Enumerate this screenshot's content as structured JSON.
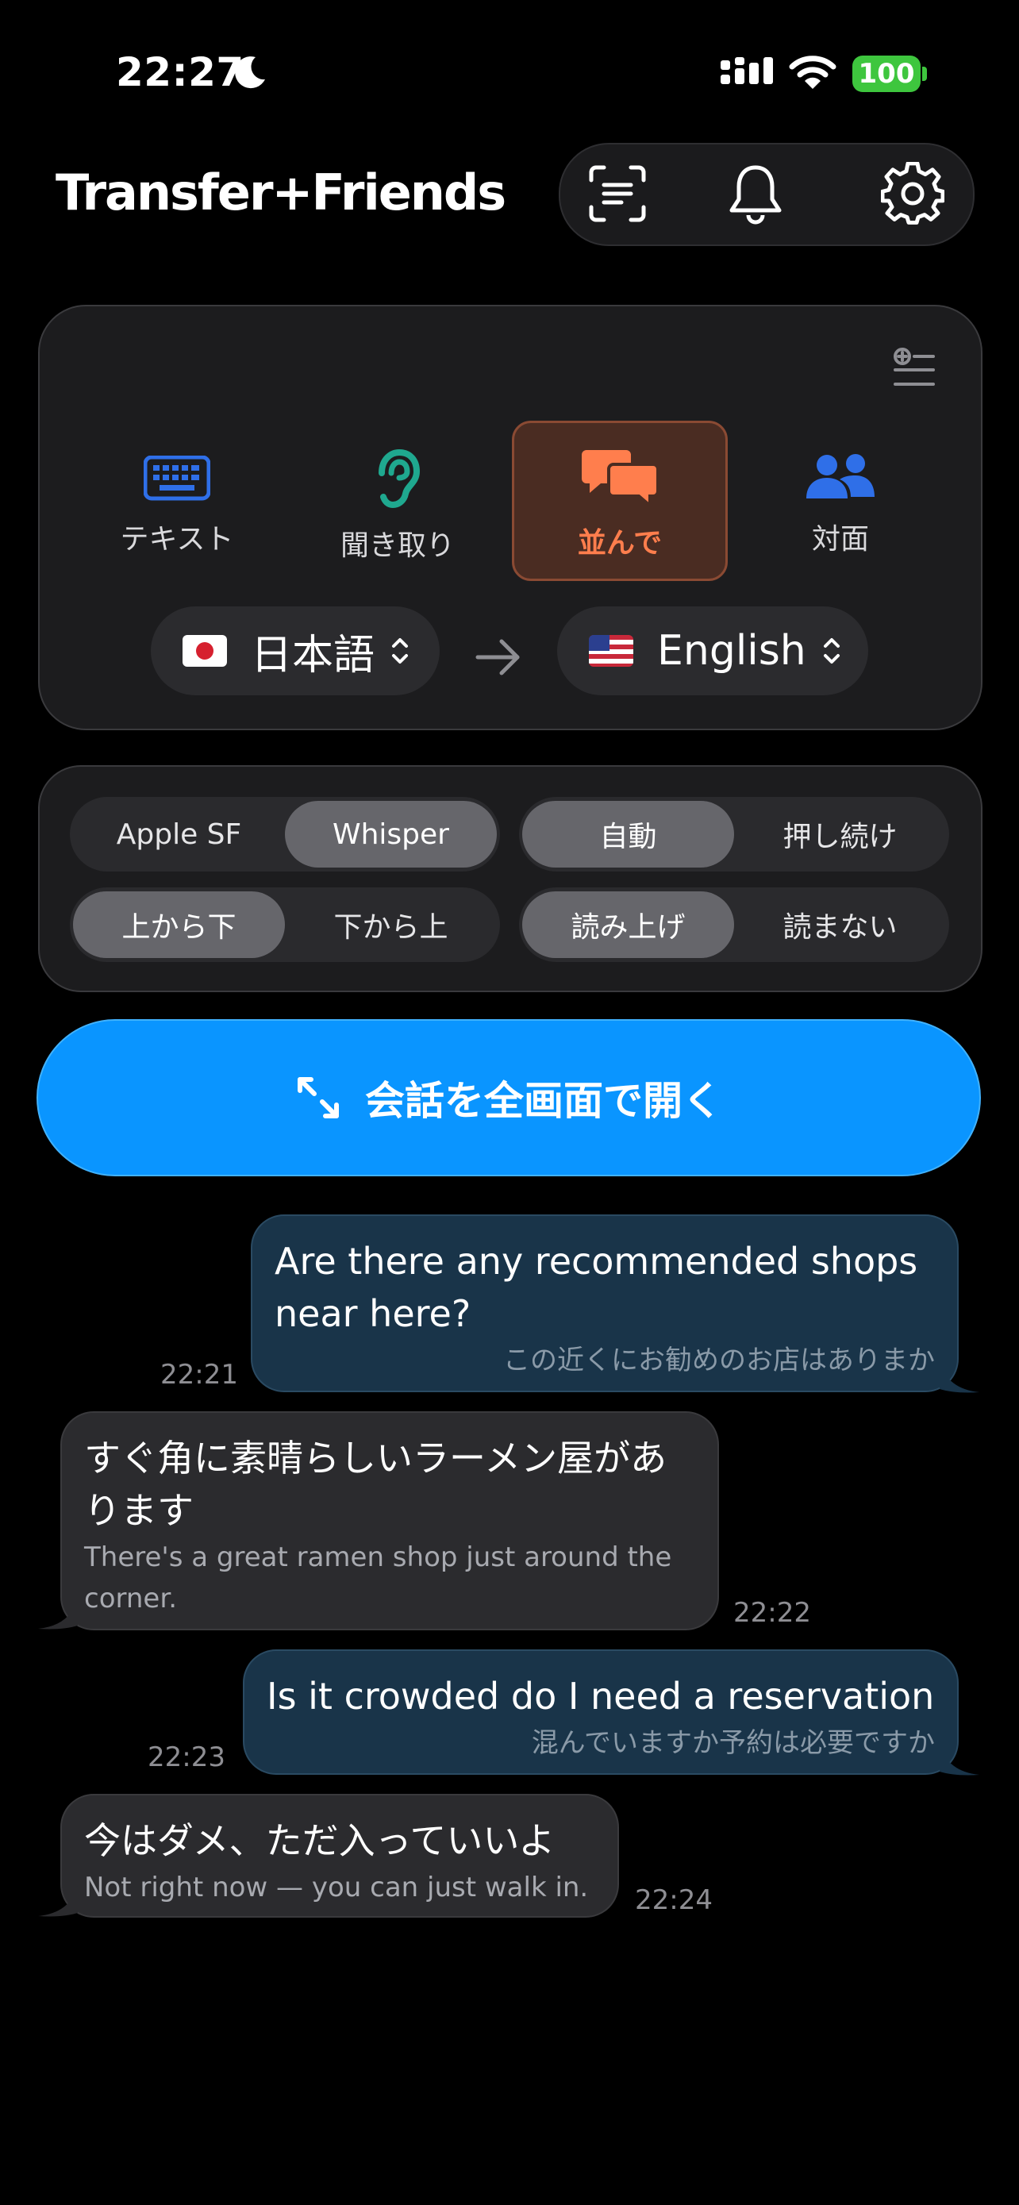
{
  "status": {
    "time": "22:27",
    "battery": "100"
  },
  "header": {
    "logo": "Transfer+Friends"
  },
  "modes": [
    {
      "label": "テキスト",
      "icon": "keyboard-icon",
      "color": "#2f6fe8"
    },
    {
      "label": "聞き取り",
      "icon": "ear-icon",
      "color": "#1fa88f"
    },
    {
      "label": "並んで",
      "icon": "chat-bubbles-icon",
      "color": "#ff7e4d",
      "active": true
    },
    {
      "label": "対面",
      "icon": "people-icon",
      "color": "#2f6fe8"
    }
  ],
  "languages": {
    "source": "日本語",
    "target": "English"
  },
  "settings": {
    "engine": [
      "Apple SF",
      "Whisper"
    ],
    "mic_mode": [
      "自動",
      "押し続け"
    ],
    "direction": [
      "上から下",
      "下から上"
    ],
    "speech": [
      "読み上げ",
      "読まない"
    ]
  },
  "open_button": {
    "label": "会話を全画面で開く"
  },
  "messages": [
    {
      "side": "me",
      "text": "Are there any recommended shops near here?",
      "sub": "この近くにお勧めのお店はありまか",
      "time": "22:21"
    },
    {
      "side": "them",
      "text": "すぐ角に素晴らしいラーメン屋があります",
      "sub": "There's a great ramen shop just around the corner.",
      "time": "22:22"
    },
    {
      "side": "me",
      "text": "Is it crowded do I need a reservation",
      "sub": "混んでいますか予約は必要ですか",
      "time": "22:23"
    },
    {
      "side": "them",
      "text": "今はダメ、ただ入っていいよ",
      "sub": "Not right now — you can just walk in.",
      "time": "22:24"
    }
  ]
}
